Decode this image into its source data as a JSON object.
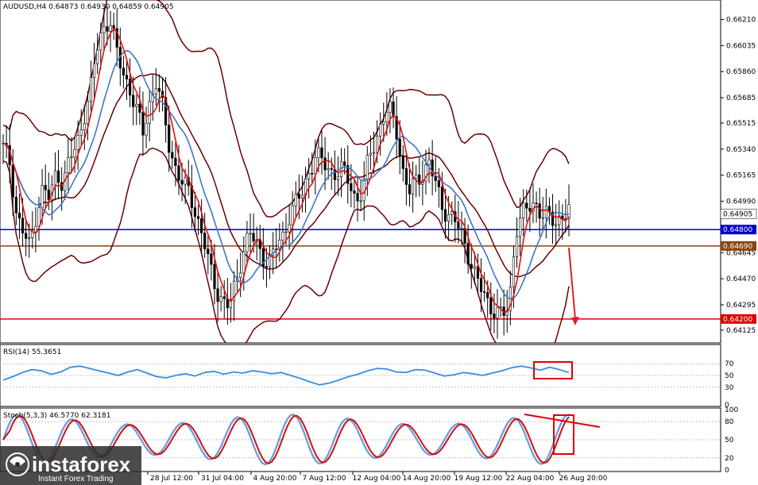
{
  "chart_data": [
    {
      "type": "candlestick",
      "header": "AUDUSD,H4  0.64873 0.64930 0.64859 0.64905",
      "ylim": [
        0.6405,
        0.6633
      ],
      "y_ticks": [
        "0.66210",
        "0.66035",
        "0.65860",
        "0.65685",
        "0.65515",
        "0.65340",
        "0.65165",
        "0.64990",
        "0.64645",
        "0.64470",
        "0.64295",
        "0.64125"
      ],
      "current_price": "0.64905",
      "levels": [
        {
          "value": 0.648,
          "label": "0.64800",
          "color": "#0000cc"
        },
        {
          "value": 0.6469,
          "label": "0.64690",
          "color": "#8b4513"
        },
        {
          "value": 0.642,
          "label": "0.64200",
          "color": "#e00000"
        }
      ],
      "close_path": [
        0.6535,
        0.6525,
        0.649,
        0.6478,
        0.6468,
        0.6492,
        0.6508,
        0.65,
        0.652,
        0.651,
        0.6528,
        0.6535,
        0.6555,
        0.657,
        0.66,
        0.6615,
        0.6622,
        0.66,
        0.6585,
        0.6575,
        0.656,
        0.6545,
        0.6565,
        0.658,
        0.656,
        0.6535,
        0.652,
        0.651,
        0.6505,
        0.649,
        0.6475,
        0.6455,
        0.644,
        0.6432,
        0.6428,
        0.6445,
        0.6465,
        0.6478,
        0.647,
        0.6462,
        0.6458,
        0.6468,
        0.6475,
        0.649,
        0.6498,
        0.6505,
        0.652,
        0.653,
        0.6525,
        0.652,
        0.6518,
        0.652,
        0.6512,
        0.65,
        0.6505,
        0.653,
        0.654,
        0.6555,
        0.656,
        0.655,
        0.652,
        0.6505,
        0.6512,
        0.6518,
        0.6525,
        0.651,
        0.6495,
        0.649,
        0.6485,
        0.6475,
        0.6462,
        0.6448,
        0.6438,
        0.643,
        0.6425,
        0.6422,
        0.6428,
        0.648,
        0.649,
        0.6495,
        0.6498,
        0.649,
        0.6488,
        0.6485,
        0.649,
        0.6492
      ]
    },
    {
      "type": "line",
      "name": "RSI(14)",
      "header": "RSI(14) 55.3651",
      "ylim": [
        0,
        100
      ],
      "y_ticks": [
        "70",
        "50",
        "30",
        "0"
      ],
      "values": [
        42,
        48,
        55,
        60,
        58,
        52,
        56,
        64,
        66,
        62,
        58,
        54,
        50,
        56,
        60,
        54,
        48,
        46,
        50,
        53,
        49,
        55,
        57,
        52,
        56,
        54,
        58,
        56,
        53,
        55,
        50,
        45,
        39,
        34,
        37,
        42,
        48,
        52,
        58,
        62,
        61,
        56,
        55,
        60,
        59,
        54,
        49,
        51,
        55,
        53,
        50,
        54,
        58,
        63,
        66,
        63,
        59,
        64,
        60,
        55
      ]
    },
    {
      "type": "line",
      "name": "Stoch(5,3,3)",
      "header": "Stoch(5,3,3) 46.5770 62.3181",
      "ylim": [
        0,
        100
      ],
      "y_ticks": [
        "100",
        "80",
        "50",
        "20",
        "0"
      ]
    }
  ],
  "x_labels": [
    "28 Jul 12:00",
    "31 Jul 04:00",
    "4 Aug 20:00",
    "7 Aug 12:00",
    "12 Aug 04:00",
    "14 Aug 20:00",
    "19 Aug 12:00",
    "22 Aug 04:00",
    "26 Aug 20:00"
  ],
  "watermark": {
    "brand": "instaforex",
    "tagline": "Instant Forex Trading"
  }
}
